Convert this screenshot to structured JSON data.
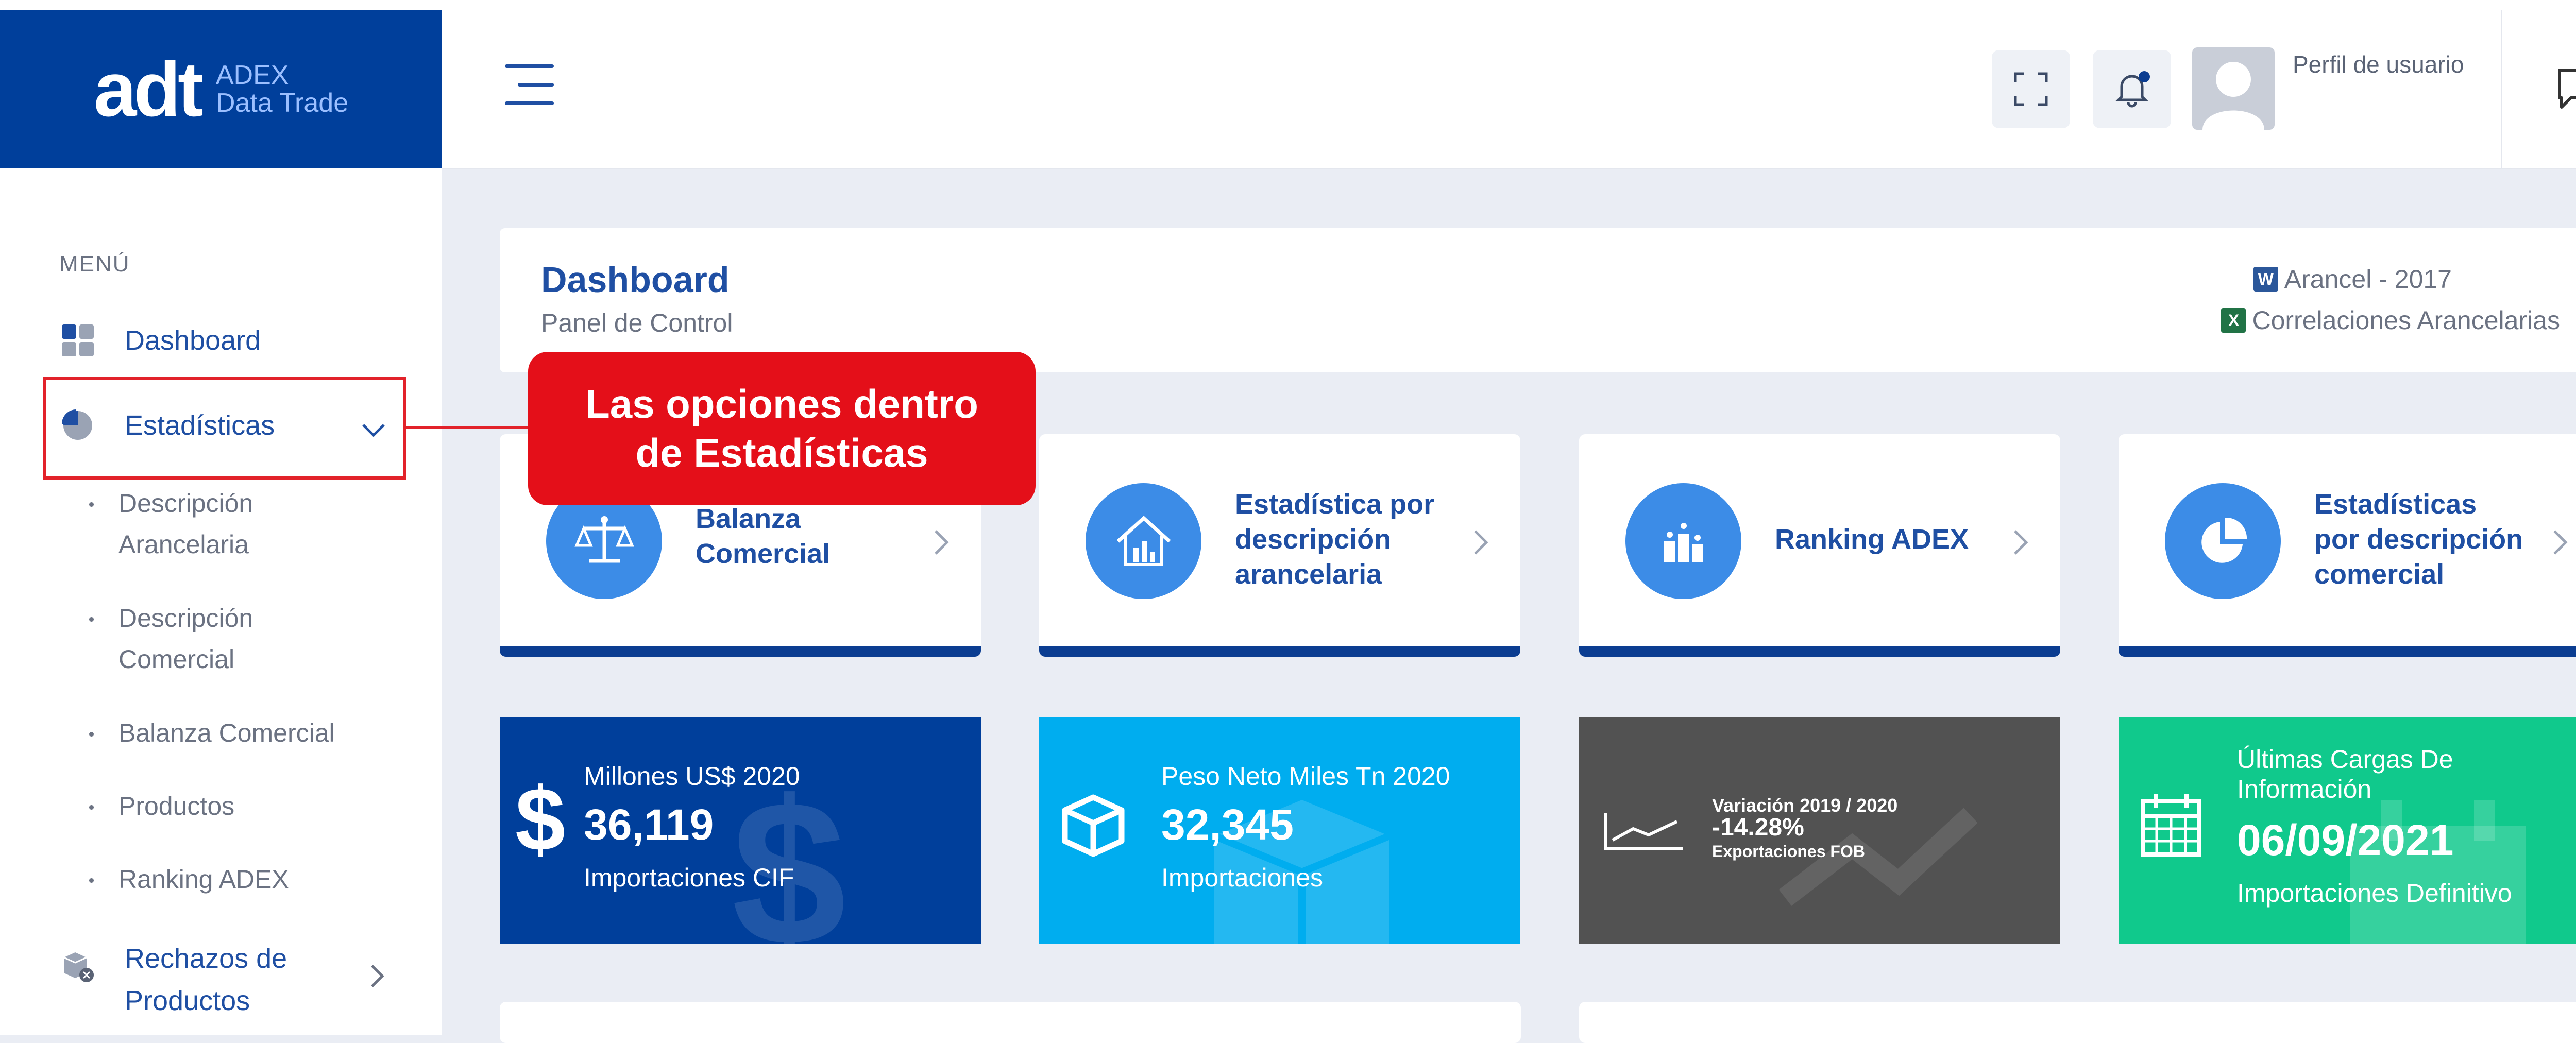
{
  "brand": {
    "logo": "adt",
    "sub_line1": "ADEX",
    "sub_line2": "Data Trade",
    "primary_color": "#003f9b",
    "accent_red": "#e40f19"
  },
  "header": {
    "profile_label": "Perfil de usuario"
  },
  "sidebar": {
    "menu_heading": "MENÚ",
    "items": [
      {
        "label": "Dashboard",
        "icon": "dashboard-grid-icon"
      },
      {
        "label": "Estadísticas",
        "icon": "pie-chart-icon",
        "expanded": true
      },
      {
        "label_line1": "Rechazos de",
        "label_line2": "Productos",
        "icon": "box-reject-icon"
      }
    ],
    "subitems": [
      {
        "line1": "Descripción",
        "line2": "Arancelaria"
      },
      {
        "line1": "Descripción",
        "line2": "Comercial"
      },
      {
        "line1": "Balanza Comercial"
      },
      {
        "line1": "Productos"
      },
      {
        "line1": "Ranking ADEX"
      }
    ]
  },
  "callout": {
    "line1": "Las opciones dentro",
    "line2": "de Estadísticas"
  },
  "page": {
    "title": "Dashboard",
    "subtitle": "Panel de Control",
    "links": [
      {
        "label": "Arancel - 2017",
        "icon": "word-doc-icon",
        "color": "#2b579a"
      },
      {
        "label": "Correlaciones Arancelarias",
        "icon": "excel-doc-icon",
        "color": "#217346"
      }
    ]
  },
  "nav_cards": [
    {
      "line1": "Balanza",
      "line2": "Comercial",
      "icon": "scale-icon"
    },
    {
      "line1": "Estadística por",
      "line2": "descripción",
      "line3": "arancelaria",
      "icon": "bar-chart-house-icon"
    },
    {
      "line1": "Ranking ADEX",
      "icon": "ranking-podium-icon"
    },
    {
      "line1": "Estadísticas",
      "line2": "por descripción",
      "line3": "comercial",
      "icon": "pie-chart-icon"
    }
  ],
  "stat_cards": [
    {
      "caption": "Millones US$ 2020",
      "value": "36,119",
      "footer": "Importaciones CIF",
      "color": "#003f9b",
      "icon": "dollar-icon"
    },
    {
      "caption": "Peso Neto Miles Tn 2020",
      "value": "32,345",
      "footer": "Importaciones",
      "color": "#00adef",
      "icon": "cube-icon"
    },
    {
      "caption": "Variación 2019 / 2020",
      "value": "-14.28%",
      "footer": "Exportaciones FOB",
      "color": "#525252",
      "icon": "trend-line-icon"
    },
    {
      "caption_line1": "Últimas Cargas De",
      "caption_line2": "Información",
      "value": "06/09/2021",
      "footer": "Importaciones Definitivo",
      "color": "#10c98c",
      "icon": "calendar-icon"
    }
  ]
}
